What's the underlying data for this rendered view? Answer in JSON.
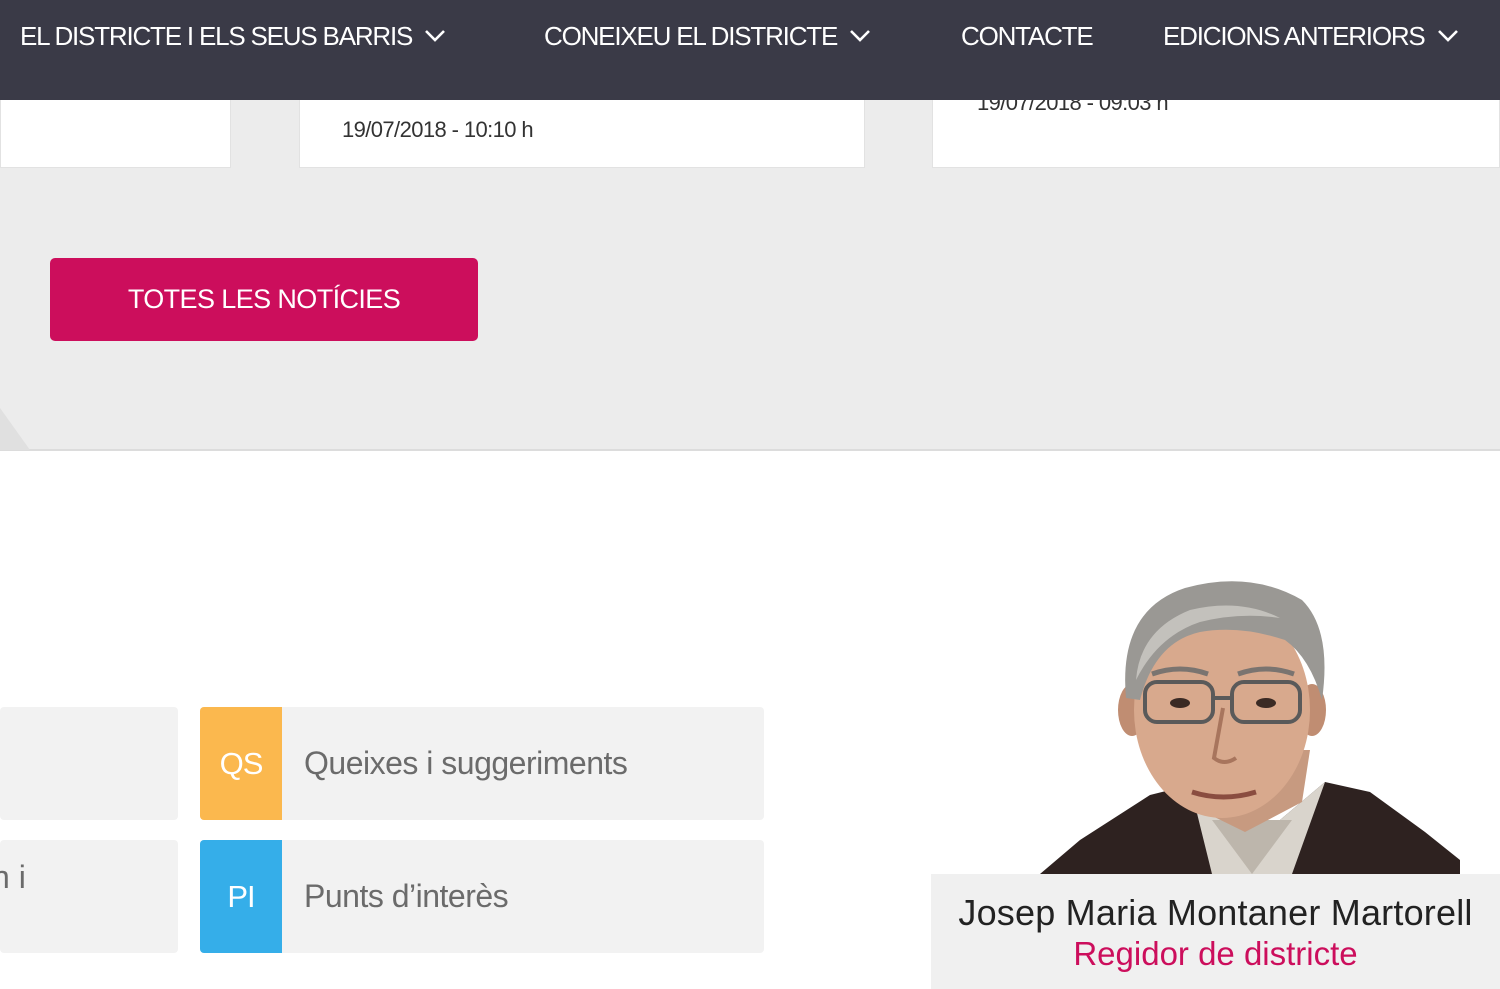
{
  "nav": {
    "items": [
      {
        "label": "EL DISTRICTE I ELS SEUS BARRIS",
        "has_dropdown": true
      },
      {
        "label": "CONEIXEU EL DISTRICTE",
        "has_dropdown": true
      },
      {
        "label": "CONTACTE",
        "has_dropdown": false
      },
      {
        "label": "EDICIONS ANTERIORS",
        "has_dropdown": true
      }
    ]
  },
  "news": {
    "cards": [
      {
        "date": ""
      },
      {
        "date": "19/07/2018 - 10:10 h"
      },
      {
        "date": "19/07/2018 - 09:03 h"
      }
    ],
    "all_news_button": "TOTES LES NOTÍCIES"
  },
  "quick_links": [
    {
      "badge": "",
      "label": ""
    },
    {
      "badge": "QS",
      "label": "Queixes i suggeriments",
      "color": "#fbb84e"
    },
    {
      "badge": "",
      "label": "n i"
    },
    {
      "badge": "PI",
      "label": "Punts d’interès",
      "color": "#35aee9"
    }
  ],
  "councillor": {
    "name": "Josep Maria Montaner Martorell",
    "role": "Regidor de districte"
  },
  "colors": {
    "nav_bg": "#3a3a47",
    "accent": "#cc0e5c",
    "band_bg": "#ececec"
  }
}
